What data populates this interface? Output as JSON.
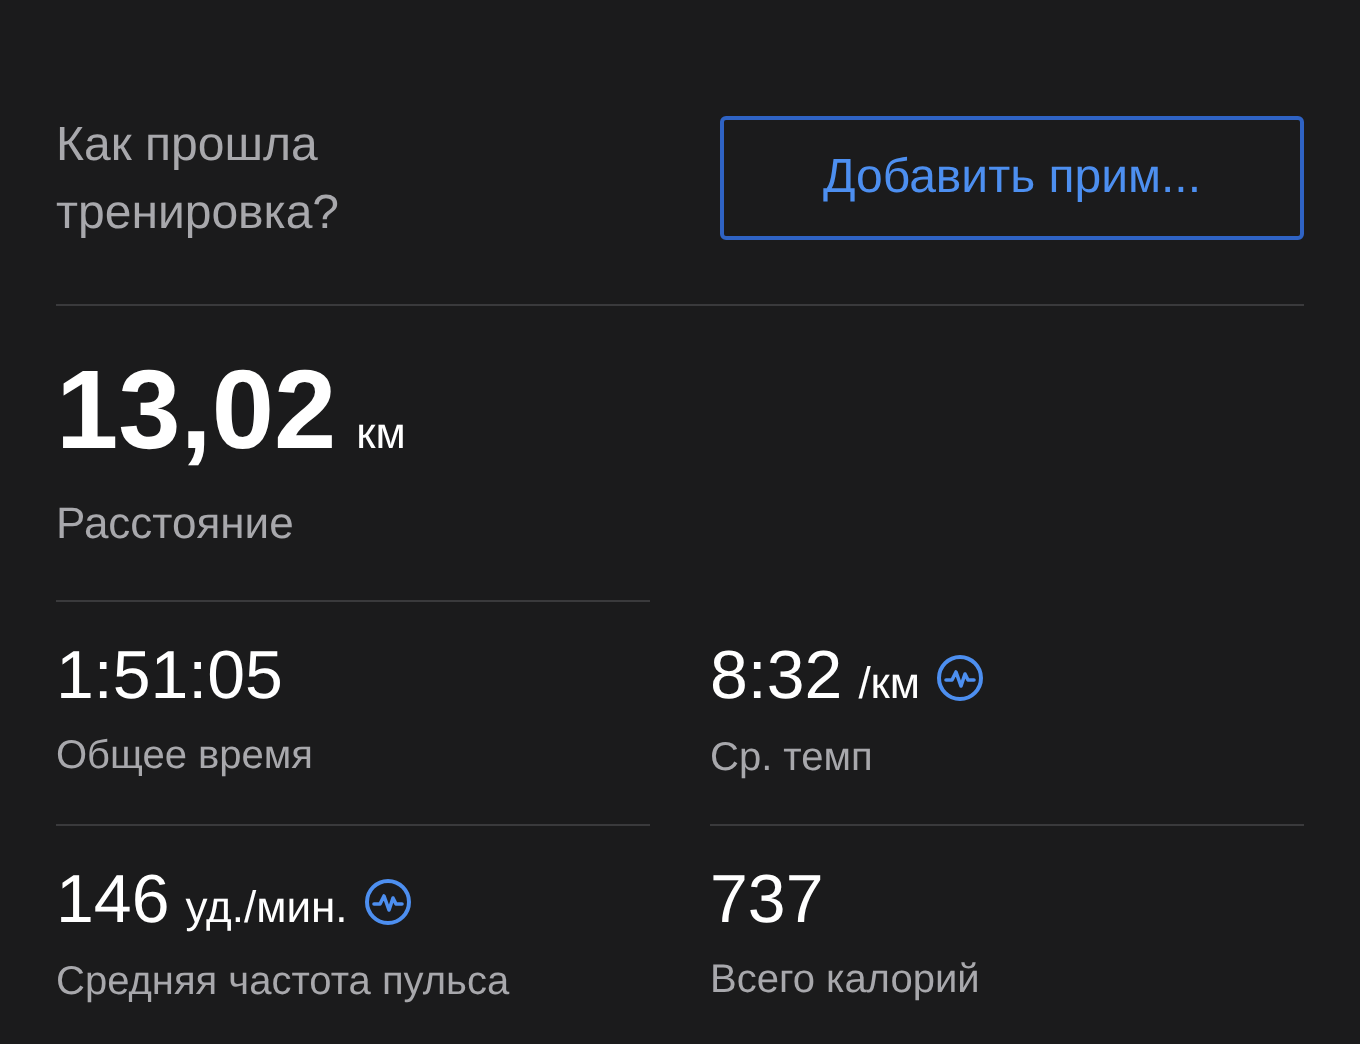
{
  "feedback": {
    "question": "Как прошла тренировка?",
    "button": "Добавить прим..."
  },
  "distance": {
    "value": "13,02",
    "unit": "км",
    "label": "Расстояние"
  },
  "stats": [
    {
      "value": "1:51:05",
      "label": "Общее время",
      "chart_icon": false
    },
    {
      "value": "8:32",
      "unit": "/км",
      "label": "Ср. темп",
      "chart_icon": true
    },
    {
      "value": "146",
      "unit": "уд./мин.",
      "label": "Средняя частота пульса",
      "chart_icon": true
    },
    {
      "value": "737",
      "label": "Всего калорий",
      "chart_icon": false
    }
  ]
}
